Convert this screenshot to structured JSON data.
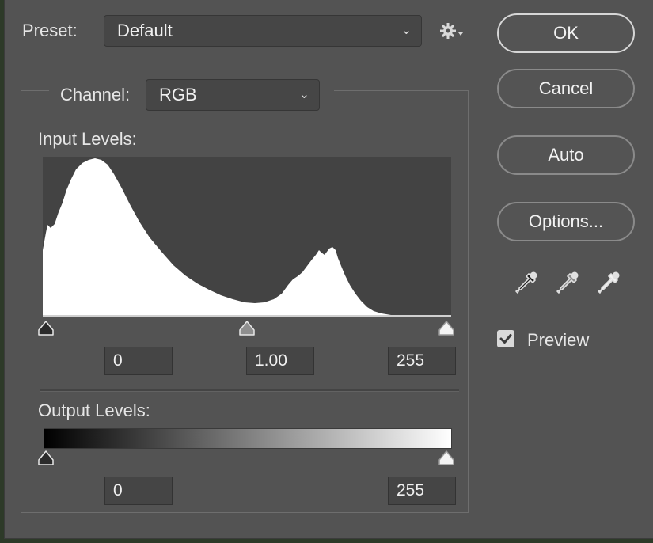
{
  "preset": {
    "label": "Preset:",
    "value": "Default"
  },
  "channel": {
    "label": "Channel:",
    "value": "RGB"
  },
  "input_levels": {
    "label": "Input Levels:",
    "black": "0",
    "gamma": "1.00",
    "white": "255"
  },
  "output_levels": {
    "label": "Output Levels:",
    "black": "0",
    "white": "255"
  },
  "buttons": {
    "ok": "OK",
    "cancel": "Cancel",
    "auto": "Auto",
    "options": "Options..."
  },
  "preview": {
    "label": "Preview",
    "checked": true
  },
  "icons": {
    "settings": "gear-icon",
    "dropdown": "chevron-down-icon",
    "black_point": "eyedropper-black-icon",
    "gray_point": "eyedropper-gray-icon",
    "white_point": "eyedropper-white-icon",
    "check": "check-icon"
  },
  "colors": {
    "dialog_bg": "#535353",
    "histogram_bg": "#434343",
    "histogram_fill": "#ffffff"
  }
}
